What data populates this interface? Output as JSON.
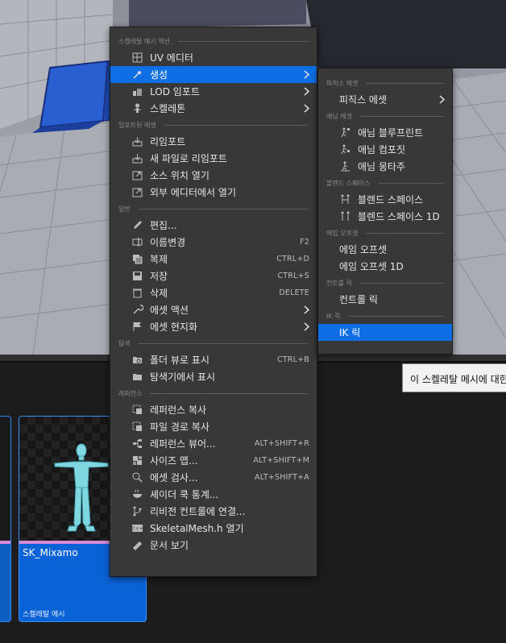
{
  "asset": {
    "name": "SK_Mixamo",
    "type_label": "스켈레탈 메시"
  },
  "menu": {
    "sections": [
      {
        "id": "skeletal",
        "title": "스켈레탈 메시 액션",
        "items": [
          {
            "label": "UV 에디터",
            "icon": "uv-grid-icon"
          },
          {
            "label": "생성",
            "icon": "create-wand-icon",
            "submenu": true,
            "highlighted": true
          },
          {
            "label": "LOD 임포트",
            "icon": "lod-icon",
            "submenu": true
          },
          {
            "label": "스켈레톤",
            "icon": "skeleton-icon",
            "submenu": true
          }
        ]
      },
      {
        "id": "imported",
        "title": "임포트된 에셋",
        "items": [
          {
            "label": "리임포트",
            "icon": "reimport-icon"
          },
          {
            "label": "새 파일로 리임포트",
            "icon": "reimport-new-icon"
          },
          {
            "label": "소스 위치 열기",
            "icon": "open-source-icon"
          },
          {
            "label": "외부 에디터에서 열기",
            "icon": "open-external-icon"
          }
        ]
      },
      {
        "id": "general",
        "title": "일반",
        "items": [
          {
            "label": "편집...",
            "icon": "pencil-icon"
          },
          {
            "label": "이름변경",
            "icon": "rename-icon",
            "shortcut": "F2"
          },
          {
            "label": "복제",
            "icon": "duplicate-icon",
            "shortcut": "CTRL+D"
          },
          {
            "label": "저장",
            "icon": "save-icon",
            "shortcut": "CTRL+S"
          },
          {
            "label": "삭제",
            "icon": "trash-icon",
            "shortcut": "DELETE"
          },
          {
            "label": "에셋 액션",
            "icon": "wrench-icon",
            "submenu": true
          },
          {
            "label": "에셋 현지화",
            "icon": "flag-icon",
            "submenu": true
          }
        ]
      },
      {
        "id": "explore",
        "title": "탐색",
        "items": [
          {
            "label": "폴더 뷰로 표시",
            "icon": "folder-search-icon",
            "shortcut": "CTRL+B"
          },
          {
            "label": "탐색기에서 표시",
            "icon": "folder-explorer-icon"
          }
        ]
      },
      {
        "id": "references",
        "title": "레퍼런스",
        "items": [
          {
            "label": "레퍼런스 복사",
            "icon": "copy-reference-icon"
          },
          {
            "label": "파일 경로 복사",
            "icon": "copy-path-icon"
          },
          {
            "label": "레퍼런스 뷰어...",
            "icon": "reference-viewer-icon",
            "shortcut": "ALT+SHIFT+R"
          },
          {
            "label": "사이즈 맵...",
            "icon": "size-map-icon",
            "shortcut": "ALT+SHIFT+M"
          },
          {
            "label": "에셋 검사...",
            "icon": "audit-icon",
            "shortcut": "ALT+SHIFT+A"
          },
          {
            "label": "셰이더 쿡 통계...",
            "icon": "shader-cook-icon"
          },
          {
            "label": "리비전 컨트롤에 연결...",
            "icon": "revision-control-icon"
          },
          {
            "label": "SkeletalMesh.h 열기",
            "icon": "cpp-header-icon"
          },
          {
            "label": "문서 보기",
            "icon": "docs-icon"
          }
        ]
      }
    ]
  },
  "submenu": {
    "sections": [
      {
        "id": "physics",
        "title": "피직스 에셋",
        "items": [
          {
            "label": "피직스 에셋",
            "submenu": true
          }
        ]
      },
      {
        "id": "anim",
        "title": "애님 에셋",
        "items": [
          {
            "label": "애님 블루프린트",
            "icon": "anim-blueprint-icon"
          },
          {
            "label": "애님 컴포짓",
            "icon": "anim-composite-icon"
          },
          {
            "label": "애님 몽타주",
            "icon": "anim-montage-icon"
          }
        ]
      },
      {
        "id": "blend",
        "title": "블렌드 스페이스",
        "items": [
          {
            "label": "블렌드 스페이스",
            "icon": "blendspace-icon"
          },
          {
            "label": "블렌드 스페이스 1D",
            "icon": "blendspace-1d-icon"
          }
        ]
      },
      {
        "id": "aimoffset",
        "title": "에임 오프셋",
        "items": [
          {
            "label": "에임 오프셋"
          },
          {
            "label": "에임 오프셋 1D"
          }
        ]
      },
      {
        "id": "controlrig",
        "title": "컨트롤 릭",
        "items": [
          {
            "label": "컨트롤 릭"
          }
        ]
      },
      {
        "id": "ikrig",
        "title": "IK 릭",
        "items": [
          {
            "label": "IK 릭",
            "highlighted": true
          }
        ]
      }
    ]
  },
  "tooltip": {
    "text": "이 스켈레탈 메시에 대한"
  },
  "colors": {
    "highlight": "#0d6ee6",
    "menu_bg": "#383838",
    "asset_tile": "#0a63d6",
    "mesh_strip": "#d78ad8"
  }
}
